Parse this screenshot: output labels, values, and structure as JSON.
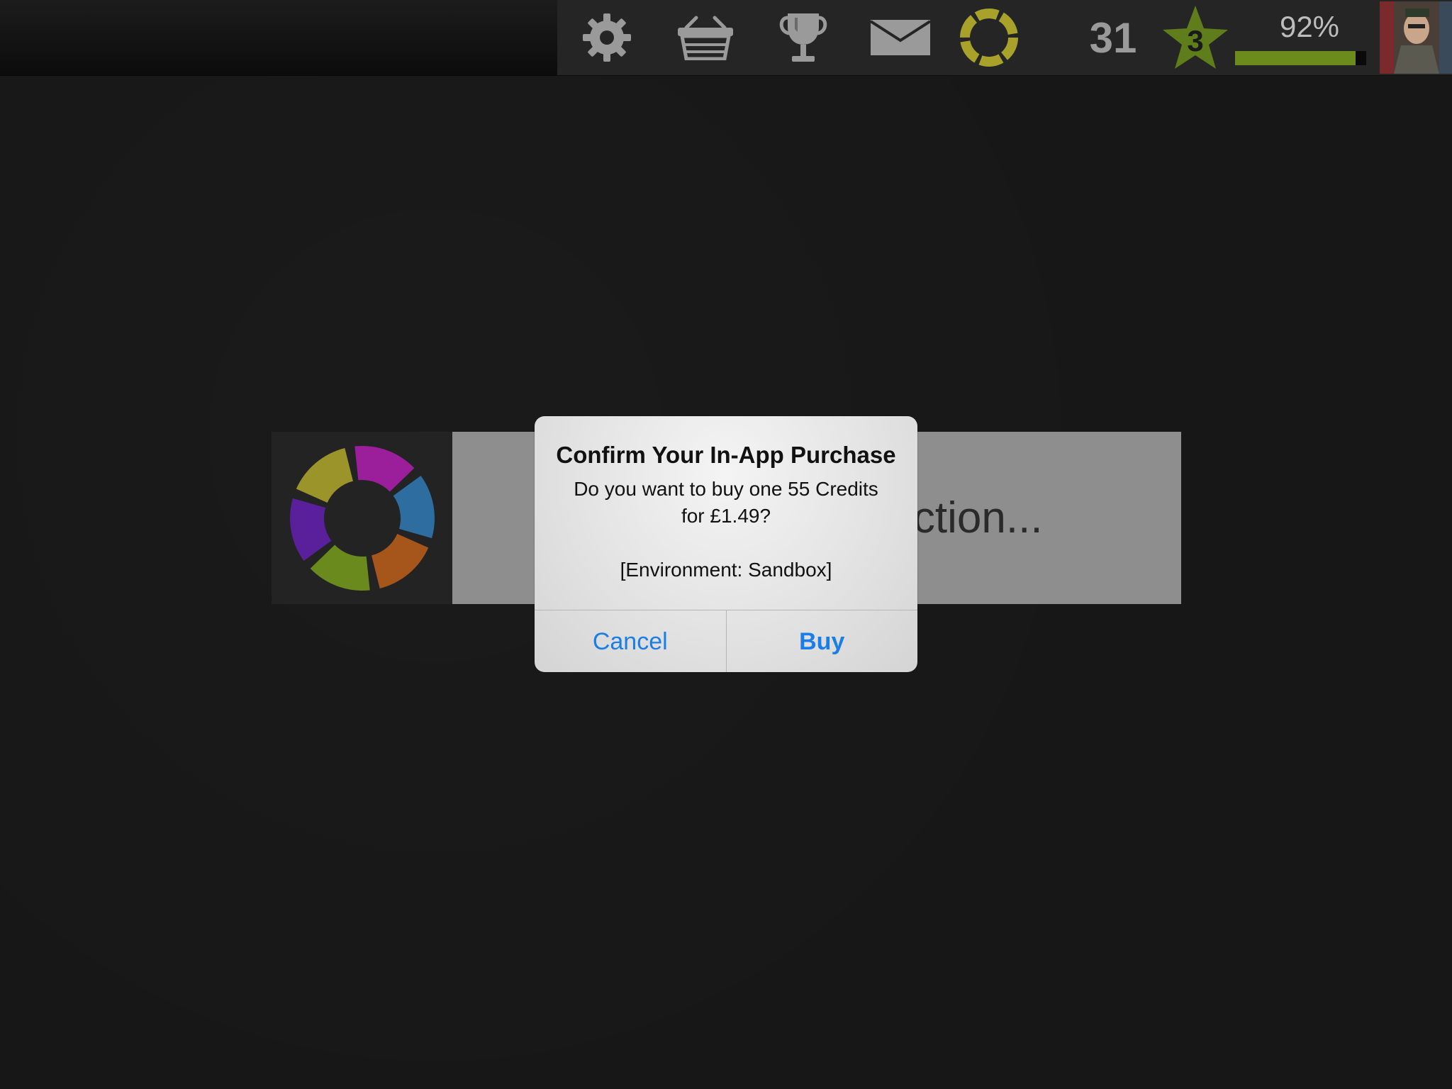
{
  "topbar": {
    "icons": [
      "gear-icon",
      "basket-icon",
      "trophy-icon",
      "mail-icon",
      "spinner-ring-icon"
    ],
    "xp_count": "31",
    "level": "3",
    "progress_label": "92%",
    "progress_value": 0.92
  },
  "banner": {
    "status_text": "action..."
  },
  "alert": {
    "title": "Confirm Your In-App Purchase",
    "message_line1": "Do you want to buy one 55 Credits",
    "message_line2": "for £1.49?",
    "environment": "[Environment: Sandbox]",
    "cancel_label": "Cancel",
    "buy_label": "Buy"
  },
  "colors": {
    "accent_green": "#6b8c1c",
    "ios_blue": "#1a7ee6",
    "ring_yellow": "#a8a12a"
  }
}
